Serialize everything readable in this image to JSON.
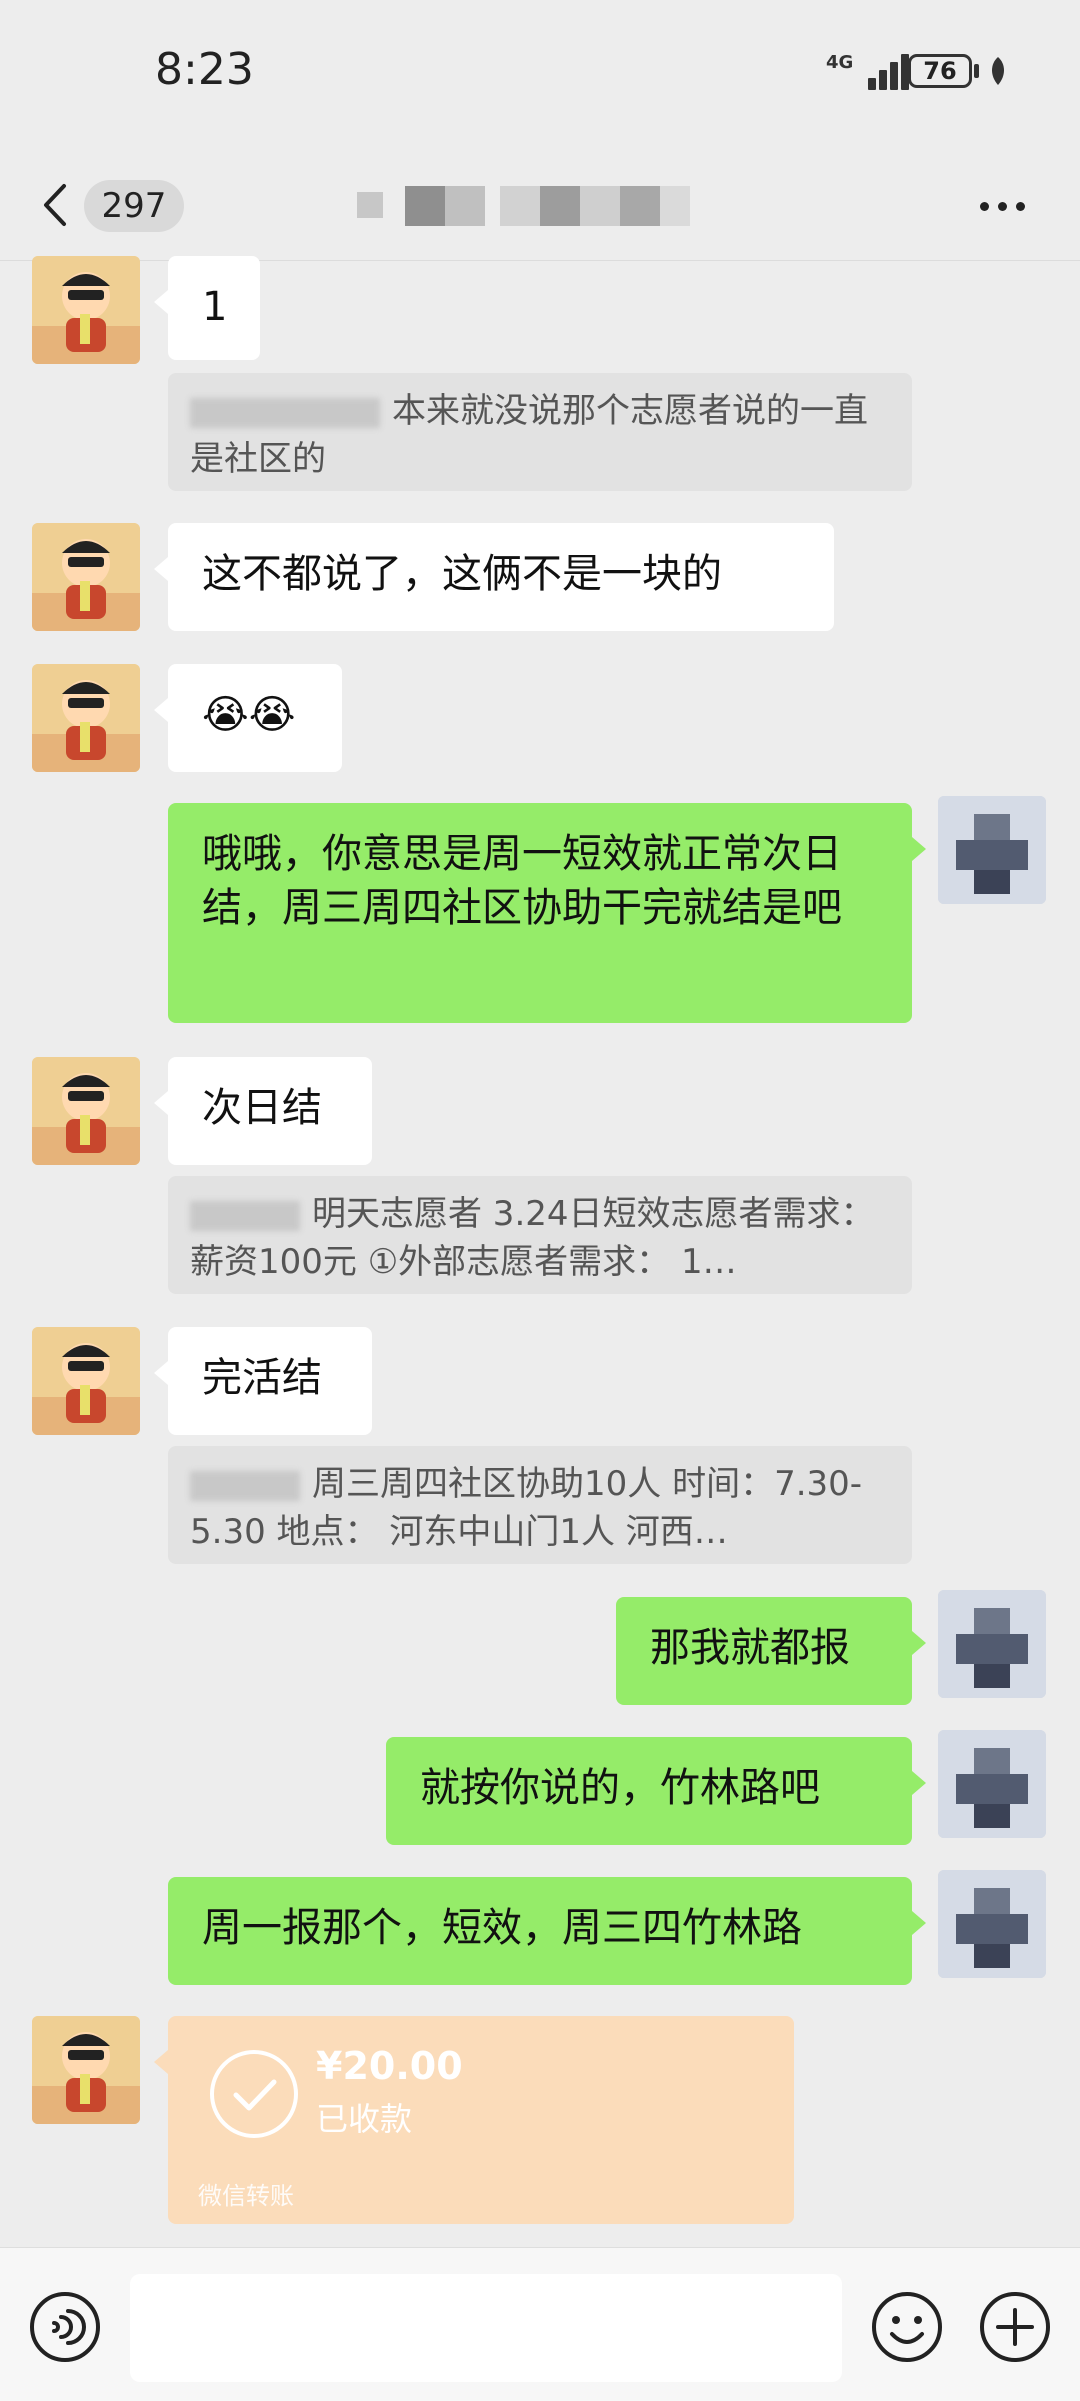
{
  "status_bar": {
    "time": "8:23",
    "network": "4G",
    "battery": "76"
  },
  "nav": {
    "unread_count": "297"
  },
  "messages": [
    {
      "text": "1"
    },
    {
      "quote": "本来就没说那个志愿者说的一直是社区的"
    },
    {
      "text": "这不都说了，这俩不是一块的"
    },
    {
      "text": "😭😭"
    },
    {
      "text": "哦哦，你意思是周一短效就正常次日结，周三周四社区协助干完就结是吧"
    },
    {
      "text": "次日结"
    },
    {
      "quote": "明天志愿者 3.24日短效志愿者需求：  薪资100元 ①外部志愿者需求：  1…"
    },
    {
      "text": "完活结"
    },
    {
      "quote": "周三周四社区协助10人 时间：7.30-5.30 地点：  河东中山门1人 河西…"
    },
    {
      "text": "那我就都报"
    },
    {
      "text": "就按你说的，竹林路吧"
    },
    {
      "text": "周一报那个，短效，周三四竹林路"
    }
  ],
  "transfer": {
    "amount": "¥20.00",
    "status": "已收款",
    "label": "微信转账"
  },
  "colors": {
    "background": "#ededed",
    "sent_bubble": "#95ec69",
    "received_bubble": "#ffffff",
    "transfer": "#fbdcba"
  },
  "icons": [
    "back-arrow-icon",
    "more-icon",
    "voice-icon",
    "emoji-icon",
    "plus-icon",
    "check-icon"
  ]
}
